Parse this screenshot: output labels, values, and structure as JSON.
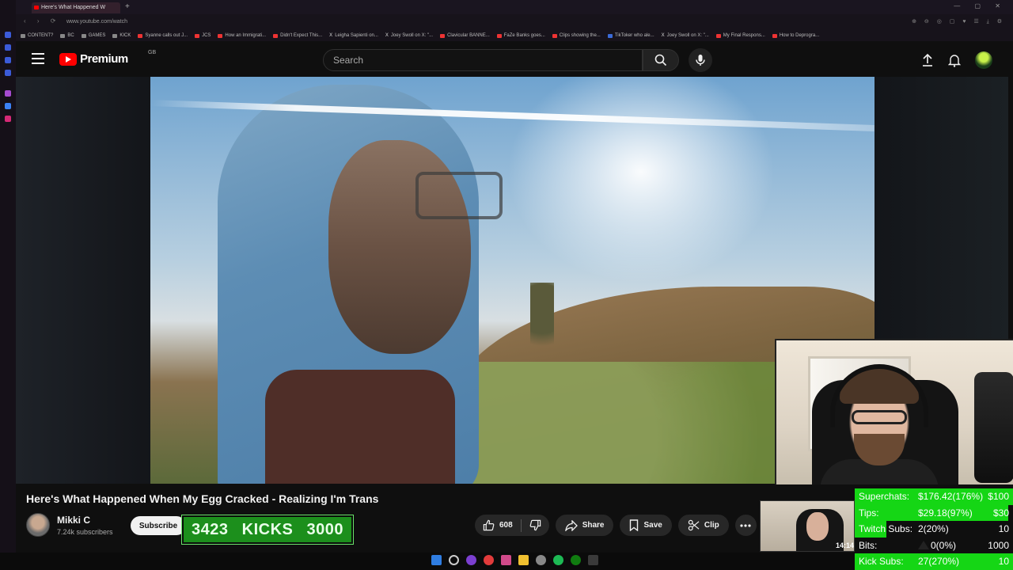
{
  "browser": {
    "tab_title": "Here's What Happened W",
    "new_tab": "+",
    "url": "www.youtube.com/watch",
    "bookmarks": [
      {
        "label": "CONTENT?",
        "icon": "folder-icon"
      },
      {
        "label": "BC",
        "icon": "folder-icon"
      },
      {
        "label": "GAMES",
        "icon": "folder-icon"
      },
      {
        "label": "KICK",
        "icon": "folder-icon"
      },
      {
        "label": "Syanne calls out J...",
        "icon": "youtube-icon"
      },
      {
        "label": "JCS",
        "icon": "youtube-icon"
      },
      {
        "label": "How an Immigrati...",
        "icon": "youtube-icon"
      },
      {
        "label": "Didn't Expect This...",
        "icon": "youtube-icon"
      },
      {
        "label": "Leigha Sapienti on...",
        "icon": "x-icon"
      },
      {
        "label": "Joey Swoll on X: \"...",
        "icon": "x-icon"
      },
      {
        "label": "Clavicular BANNE...",
        "icon": "youtube-icon"
      },
      {
        "label": "FaZe Banks goes...",
        "icon": "youtube-icon"
      },
      {
        "label": "Clips showing the...",
        "icon": "youtube-icon"
      },
      {
        "label": "TikToker who ale...",
        "icon": "facebook-icon"
      },
      {
        "label": "Joey Swoll on X: \"...",
        "icon": "x-icon"
      },
      {
        "label": "My Final Respons...",
        "icon": "youtube-icon"
      },
      {
        "label": "How to Deprogra...",
        "icon": "youtube-icon"
      }
    ]
  },
  "header": {
    "logo_text": "Premium",
    "region": "GB",
    "search_placeholder": "Search"
  },
  "video": {
    "title": "Here's What Happened When My Egg Cracked - Realizing I'm Trans",
    "channel_name": "Mikki C",
    "channel_subs": "7.24k subscribers",
    "subscribe_label": "Subscribe",
    "like_count": "608",
    "share_label": "Share",
    "save_label": "Save",
    "clip_label": "Clip"
  },
  "overlay": {
    "kicks_count": "3423",
    "kicks_label": "KICKS",
    "kicks_goal": "3000",
    "mini_cam_time": "14:14",
    "stats": [
      {
        "label": "Superchats:",
        "value": "$176.42(176%)",
        "goal": "$100",
        "progress": 1.0
      },
      {
        "label": "Tips:",
        "value": "$29.18(97%)",
        "goal": "$30",
        "progress": 0.97
      },
      {
        "label": "Twitch Subs:",
        "value": "2(20%)",
        "goal": "10",
        "progress": 0.2
      },
      {
        "label": "Bits:",
        "value": "0(0%)",
        "goal": "1000",
        "progress": 0.0
      },
      {
        "label": "Kick Subs:",
        "value": "27(270%)",
        "goal": "10",
        "progress": 1.0
      }
    ]
  },
  "colors": {
    "youtube_red": "#ff0000",
    "overlay_green": "#15d615",
    "kicks_green": "#1c8f1c"
  }
}
